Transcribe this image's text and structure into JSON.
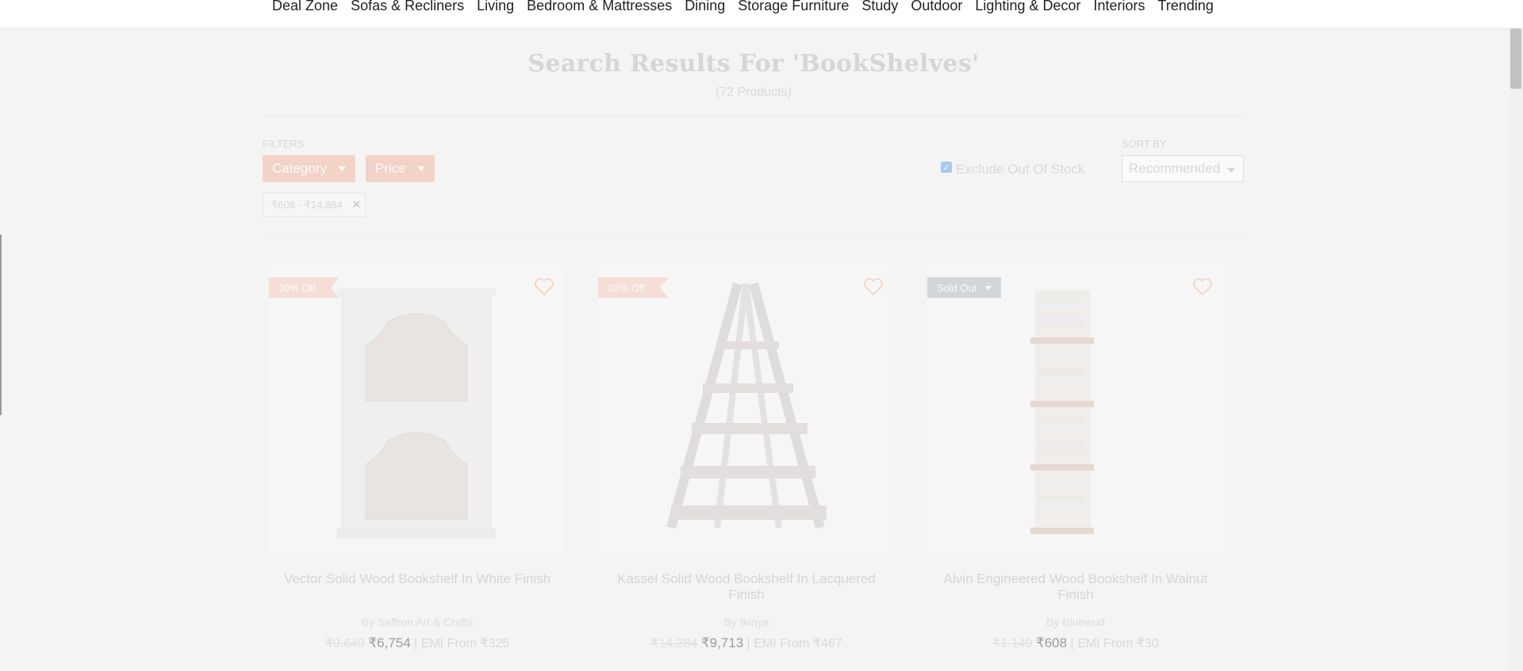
{
  "nav": {
    "items": [
      "Deal Zone",
      "Sofas & Recliners",
      "Living",
      "Bedroom & Mattresses",
      "Dining",
      "Storage Furniture",
      "Study",
      "Outdoor",
      "Lighting & Decor",
      "Interiors",
      "Trending"
    ]
  },
  "search": {
    "title": "Search Results For 'BookShelves'",
    "count": "(72 Products)"
  },
  "filters": {
    "label": "FILTERS",
    "category": "Category",
    "price": "Price",
    "active_chip": "₹608 - ₹14,884",
    "chip_close": "✕",
    "exclude_label": "Exclude Out Of Stock",
    "exclude_checked": true
  },
  "sort": {
    "label": "SORT BY",
    "selected": "Recommended"
  },
  "products": [
    {
      "badge": "30% Off",
      "name": "Vector Solid Wood Bookshelf In White Finish",
      "brand": "By Saffron Art & Crafts",
      "old_price": "₹9,649",
      "price": "₹6,754",
      "emi": "| EMI From ₹325"
    },
    {
      "badge": "32% Off",
      "name": "Kassel Solid Wood Bookshelf In Lacquered Finish",
      "brand": "By Ikinya",
      "old_price": "₹14,284",
      "price": "₹9,713",
      "emi": "| EMI From ₹467"
    },
    {
      "badge": "Sold Out",
      "name": "Alvin Engineered Wood Bookshelf In Walnut Finish",
      "brand": "By Bluewud",
      "old_price": "₹1,149",
      "price": "₹608",
      "emi": "| EMI From ₹30"
    }
  ]
}
